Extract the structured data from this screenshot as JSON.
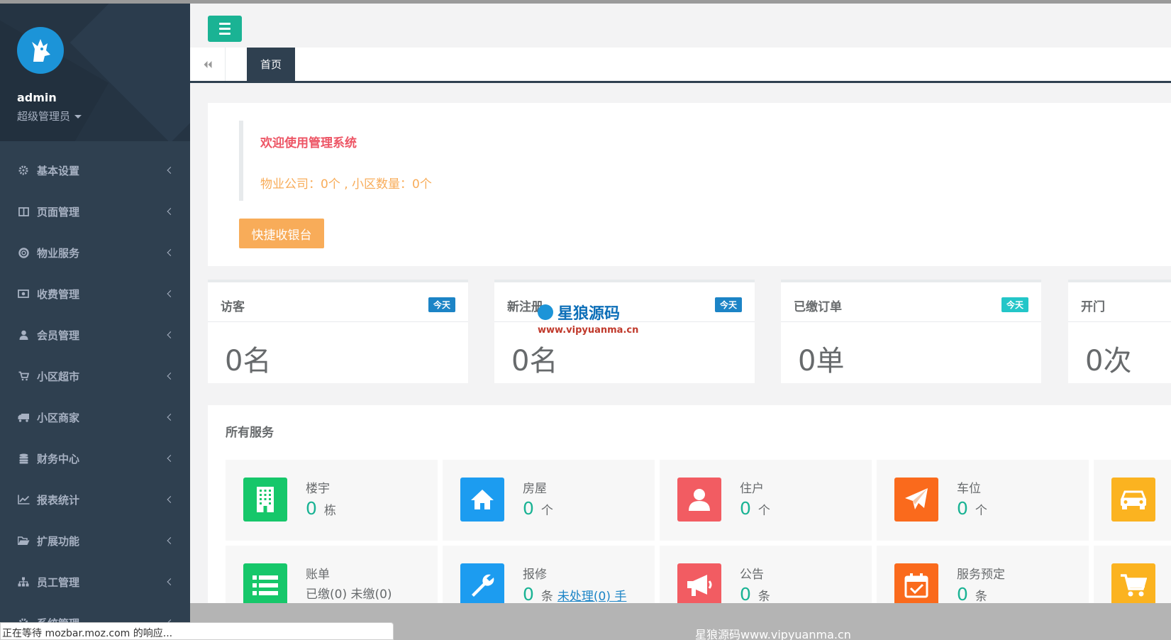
{
  "sidebar": {
    "username": "admin",
    "role": "超级管理员",
    "items": [
      {
        "label": "基本设置",
        "icon": "gear-icon"
      },
      {
        "label": "页面管理",
        "icon": "columns-icon"
      },
      {
        "label": "物业服务",
        "icon": "lifebuoy-icon"
      },
      {
        "label": "收费管理",
        "icon": "money-icon"
      },
      {
        "label": "会员管理",
        "icon": "user-icon"
      },
      {
        "label": "小区超市",
        "icon": "cart-icon"
      },
      {
        "label": "小区商家",
        "icon": "truck-icon"
      },
      {
        "label": "财务中心",
        "icon": "database-icon"
      },
      {
        "label": "报表统计",
        "icon": "line-chart-icon"
      },
      {
        "label": "扩展功能",
        "icon": "folder-open-icon"
      },
      {
        "label": "员工管理",
        "icon": "sitemap-icon"
      },
      {
        "label": "系统管理",
        "icon": "cog-icon"
      }
    ]
  },
  "tabs": {
    "home": "首页"
  },
  "welcome": {
    "title": "欢迎使用管理系统",
    "subtitle": "物业公司：0个 , 小区数量：0个",
    "cashier_button": "快捷收银台"
  },
  "stats": [
    {
      "title": "访客",
      "badge": "今天",
      "badge_color": "#1c84c6",
      "value": "0名"
    },
    {
      "title": "新注册",
      "badge": "今天",
      "badge_color": "#1c84c6",
      "value": "0名"
    },
    {
      "title": "已缴订单",
      "badge": "今天",
      "badge_color": "#23c6c8",
      "value": "0单"
    },
    {
      "title": "开门",
      "badge": "",
      "badge_color": "",
      "value": "0次"
    }
  ],
  "services": {
    "title": "所有服务",
    "row1": [
      {
        "label": "楼宇",
        "num": "0",
        "unit": "栋",
        "color": "#16c76a",
        "icon": "building-icon"
      },
      {
        "label": "房屋",
        "num": "0",
        "unit": "个",
        "color": "#1c9cf0",
        "icon": "home-icon"
      },
      {
        "label": "住户",
        "num": "0",
        "unit": "个",
        "color": "#f25c62",
        "icon": "user-icon"
      },
      {
        "label": "车位",
        "num": "0",
        "unit": "个",
        "color": "#fa6a1c",
        "icon": "paper-plane-icon"
      },
      {
        "label": "",
        "num": "",
        "unit": "",
        "color": "#fbb320",
        "icon": "car-icon"
      }
    ],
    "row2": [
      {
        "label": "账单",
        "line": "已缴(0) 未缴(0)",
        "color": "#16c76a",
        "icon": "list-icon"
      },
      {
        "label": "报修",
        "num": "0",
        "unit": "条",
        "extra": "未处理(0) 手",
        "color": "#1c9cf0",
        "icon": "wrench-icon"
      },
      {
        "label": "公告",
        "num": "0",
        "unit": "条",
        "color": "#f25c62",
        "icon": "bullhorn-icon"
      },
      {
        "label": "服务预定",
        "num": "0",
        "unit": "条",
        "color": "#fa6a1c",
        "icon": "calendar-check-icon"
      },
      {
        "label": "",
        "num": "",
        "unit": "",
        "color": "#fbb320",
        "icon": "shopping-cart-icon"
      }
    ]
  },
  "footer": {
    "text": "星狼源码www.vipyuanma.cn"
  },
  "status": {
    "text": "正在等待 mozbar.moz.com 的响应..."
  },
  "watermark": {
    "brand": "星狼源码",
    "url": "www.vipyuanma.cn"
  }
}
